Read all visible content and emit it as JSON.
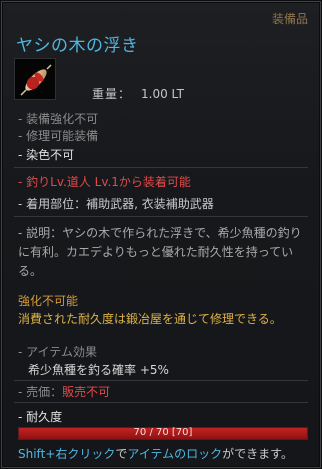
{
  "item": {
    "category": "装備品",
    "name": "ヤシの木の浮き",
    "icon": "fishing-float-icon",
    "weight_label": "重量：",
    "weight_value": "1.00 LT"
  },
  "properties": [
    "- 装備強化不可",
    "- 修理可能装備"
  ],
  "dye": "- 染色不可",
  "requirement": "- 釣りLv.道人 Lv.1から装着可能",
  "slot": "- 着用部位：補助武器, 衣装補助武器",
  "description": "- 説明：ヤシの木で作られた浮きで、希少魚種の釣りに有利。カエデよりもっと優れた耐久性を持っている。",
  "enhance_title": "強化不可能",
  "enhance_note": "消費された耐久度は鍛冶屋を通じて修理できる。",
  "effects": {
    "title": "- アイテム効果",
    "lines": [
      "希少魚種を釣る確率 +5%"
    ]
  },
  "price": {
    "label": "- 売価：",
    "value": "販売不可"
  },
  "durability": {
    "label": "- 耐久度",
    "current": 70,
    "max": 70,
    "text": "70 / 70 [70]"
  },
  "hint": {
    "part1": "Shift+右クリック",
    "part2": "で",
    "part3": "アイテムのロック",
    "part4": "ができます。"
  },
  "colors": {
    "title": "#4fb7e3",
    "warning": "#e14a4a",
    "gold": "#d79a3b",
    "category": "#8f7450"
  }
}
